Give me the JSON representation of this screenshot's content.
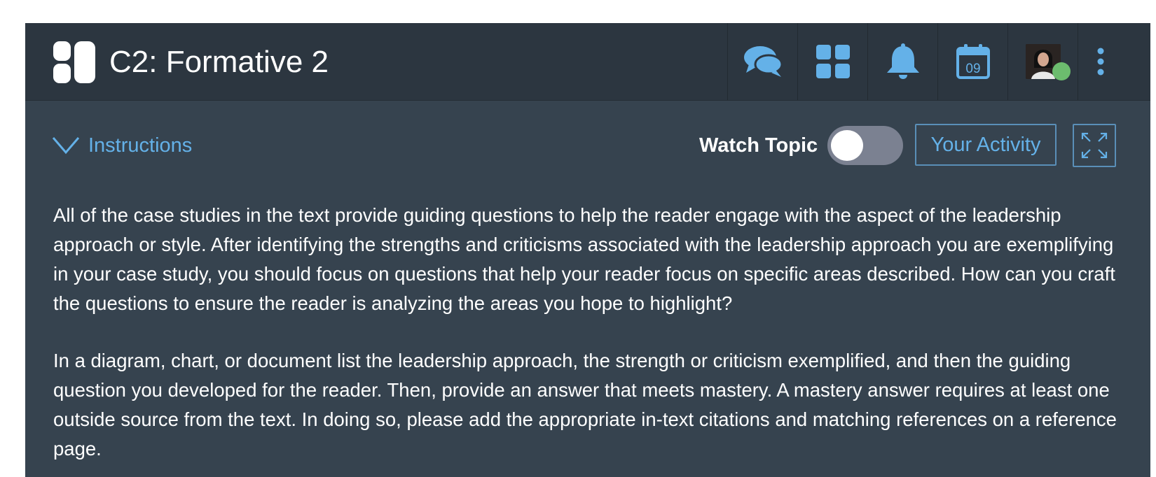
{
  "header": {
    "title": "C2: Formative 2",
    "icons": [
      "logo-icon",
      "chat-icon",
      "grid-icon",
      "bell-icon",
      "calendar-icon",
      "avatar",
      "more-vertical-icon"
    ],
    "calendar_day": "09"
  },
  "toolbar": {
    "instructions_label": "Instructions",
    "watch_topic_label": "Watch Topic",
    "watch_topic_on": false,
    "activity_label": "Your Activity"
  },
  "instructions": {
    "paragraphs": [
      "All of the case studies in the text provide guiding questions to help the reader engage with the aspect of the leadership approach or style. After identifying the strengths and criticisms associated with the leadership approach you are exemplifying in your case study, you should focus on questions that help your reader focus on specific areas described. How can you craft the questions to ensure the reader is analyzing the areas you hope to highlight?",
      "In a diagram, chart, or document list the leadership approach, the strength or criticism exemplified, and then the guiding question you developed for the reader. Then, provide an answer that meets mastery. A mastery answer requires at least one outside source from the text. In doing so, please add the appropriate in-text citations and matching references on a reference page."
    ]
  },
  "colors": {
    "accent": "#64b1e8",
    "panel_bg": "#36434f",
    "header_bg": "#2c3640",
    "presence": "#6cbc6e"
  }
}
